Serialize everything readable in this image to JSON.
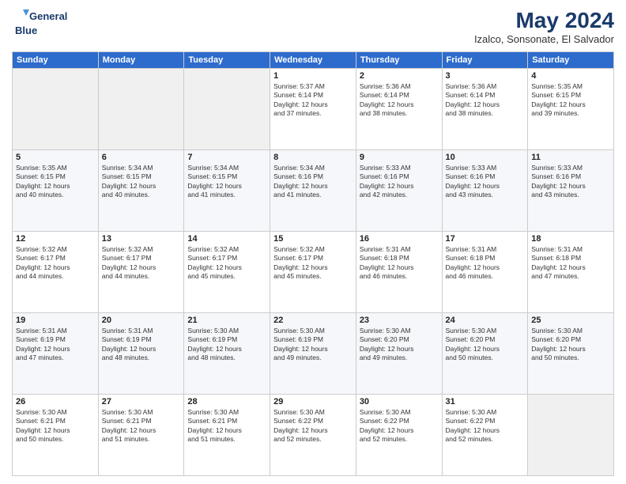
{
  "logo": {
    "line1": "General",
    "line2": "Blue"
  },
  "title": "May 2024",
  "location": "Izalco, Sonsonate, El Salvador",
  "days_of_week": [
    "Sunday",
    "Monday",
    "Tuesday",
    "Wednesday",
    "Thursday",
    "Friday",
    "Saturday"
  ],
  "weeks": [
    [
      {
        "day": "",
        "content": ""
      },
      {
        "day": "",
        "content": ""
      },
      {
        "day": "",
        "content": ""
      },
      {
        "day": "1",
        "content": "Sunrise: 5:37 AM\nSunset: 6:14 PM\nDaylight: 12 hours\nand 37 minutes."
      },
      {
        "day": "2",
        "content": "Sunrise: 5:36 AM\nSunset: 6:14 PM\nDaylight: 12 hours\nand 38 minutes."
      },
      {
        "day": "3",
        "content": "Sunrise: 5:36 AM\nSunset: 6:14 PM\nDaylight: 12 hours\nand 38 minutes."
      },
      {
        "day": "4",
        "content": "Sunrise: 5:35 AM\nSunset: 6:15 PM\nDaylight: 12 hours\nand 39 minutes."
      }
    ],
    [
      {
        "day": "5",
        "content": "Sunrise: 5:35 AM\nSunset: 6:15 PM\nDaylight: 12 hours\nand 40 minutes."
      },
      {
        "day": "6",
        "content": "Sunrise: 5:34 AM\nSunset: 6:15 PM\nDaylight: 12 hours\nand 40 minutes."
      },
      {
        "day": "7",
        "content": "Sunrise: 5:34 AM\nSunset: 6:15 PM\nDaylight: 12 hours\nand 41 minutes."
      },
      {
        "day": "8",
        "content": "Sunrise: 5:34 AM\nSunset: 6:16 PM\nDaylight: 12 hours\nand 41 minutes."
      },
      {
        "day": "9",
        "content": "Sunrise: 5:33 AM\nSunset: 6:16 PM\nDaylight: 12 hours\nand 42 minutes."
      },
      {
        "day": "10",
        "content": "Sunrise: 5:33 AM\nSunset: 6:16 PM\nDaylight: 12 hours\nand 43 minutes."
      },
      {
        "day": "11",
        "content": "Sunrise: 5:33 AM\nSunset: 6:16 PM\nDaylight: 12 hours\nand 43 minutes."
      }
    ],
    [
      {
        "day": "12",
        "content": "Sunrise: 5:32 AM\nSunset: 6:17 PM\nDaylight: 12 hours\nand 44 minutes."
      },
      {
        "day": "13",
        "content": "Sunrise: 5:32 AM\nSunset: 6:17 PM\nDaylight: 12 hours\nand 44 minutes."
      },
      {
        "day": "14",
        "content": "Sunrise: 5:32 AM\nSunset: 6:17 PM\nDaylight: 12 hours\nand 45 minutes."
      },
      {
        "day": "15",
        "content": "Sunrise: 5:32 AM\nSunset: 6:17 PM\nDaylight: 12 hours\nand 45 minutes."
      },
      {
        "day": "16",
        "content": "Sunrise: 5:31 AM\nSunset: 6:18 PM\nDaylight: 12 hours\nand 46 minutes."
      },
      {
        "day": "17",
        "content": "Sunrise: 5:31 AM\nSunset: 6:18 PM\nDaylight: 12 hours\nand 46 minutes."
      },
      {
        "day": "18",
        "content": "Sunrise: 5:31 AM\nSunset: 6:18 PM\nDaylight: 12 hours\nand 47 minutes."
      }
    ],
    [
      {
        "day": "19",
        "content": "Sunrise: 5:31 AM\nSunset: 6:19 PM\nDaylight: 12 hours\nand 47 minutes."
      },
      {
        "day": "20",
        "content": "Sunrise: 5:31 AM\nSunset: 6:19 PM\nDaylight: 12 hours\nand 48 minutes."
      },
      {
        "day": "21",
        "content": "Sunrise: 5:30 AM\nSunset: 6:19 PM\nDaylight: 12 hours\nand 48 minutes."
      },
      {
        "day": "22",
        "content": "Sunrise: 5:30 AM\nSunset: 6:19 PM\nDaylight: 12 hours\nand 49 minutes."
      },
      {
        "day": "23",
        "content": "Sunrise: 5:30 AM\nSunset: 6:20 PM\nDaylight: 12 hours\nand 49 minutes."
      },
      {
        "day": "24",
        "content": "Sunrise: 5:30 AM\nSunset: 6:20 PM\nDaylight: 12 hours\nand 50 minutes."
      },
      {
        "day": "25",
        "content": "Sunrise: 5:30 AM\nSunset: 6:20 PM\nDaylight: 12 hours\nand 50 minutes."
      }
    ],
    [
      {
        "day": "26",
        "content": "Sunrise: 5:30 AM\nSunset: 6:21 PM\nDaylight: 12 hours\nand 50 minutes."
      },
      {
        "day": "27",
        "content": "Sunrise: 5:30 AM\nSunset: 6:21 PM\nDaylight: 12 hours\nand 51 minutes."
      },
      {
        "day": "28",
        "content": "Sunrise: 5:30 AM\nSunset: 6:21 PM\nDaylight: 12 hours\nand 51 minutes."
      },
      {
        "day": "29",
        "content": "Sunrise: 5:30 AM\nSunset: 6:22 PM\nDaylight: 12 hours\nand 52 minutes."
      },
      {
        "day": "30",
        "content": "Sunrise: 5:30 AM\nSunset: 6:22 PM\nDaylight: 12 hours\nand 52 minutes."
      },
      {
        "day": "31",
        "content": "Sunrise: 5:30 AM\nSunset: 6:22 PM\nDaylight: 12 hours\nand 52 minutes."
      },
      {
        "day": "",
        "content": ""
      }
    ]
  ]
}
